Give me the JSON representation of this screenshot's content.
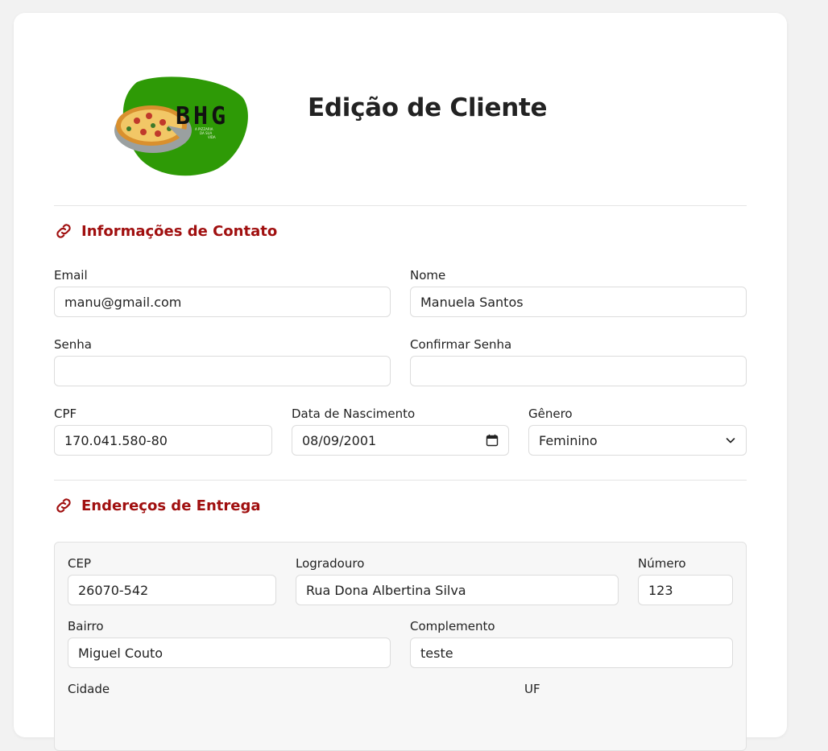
{
  "header": {
    "title": "Edição de Cliente"
  },
  "logo": {
    "text": "BHG",
    "tagline": "A PIZZARIA DA SUA VIDA",
    "bg_color": "#2e9a06"
  },
  "contact": {
    "title": "Informações de Contato",
    "email": {
      "label": "Email",
      "value": "manu@gmail.com"
    },
    "nome": {
      "label": "Nome",
      "value": "Manuela Santos"
    },
    "senha": {
      "label": "Senha",
      "value": ""
    },
    "confirmar_senha": {
      "label": "Confirmar Senha",
      "value": ""
    },
    "cpf": {
      "label": "CPF",
      "value": "170.041.580-80"
    },
    "nascimento": {
      "label": "Data de Nascimento",
      "value": "08/09/2001"
    },
    "genero": {
      "label": "Gênero",
      "value": "Feminino"
    }
  },
  "address": {
    "title": "Endereços de Entrega",
    "cep": {
      "label": "CEP",
      "value": "26070-542"
    },
    "logradouro": {
      "label": "Logradouro",
      "value": "Rua Dona Albertina Silva"
    },
    "numero": {
      "label": "Número",
      "value": "123"
    },
    "bairro": {
      "label": "Bairro",
      "value": "Miguel Couto"
    },
    "complemento": {
      "label": "Complemento",
      "value": "teste"
    },
    "cidade": {
      "label": "Cidade"
    },
    "uf": {
      "label": "UF"
    }
  },
  "colors": {
    "accent": "#a00f0f",
    "page_bg": "#f2f2f2"
  }
}
